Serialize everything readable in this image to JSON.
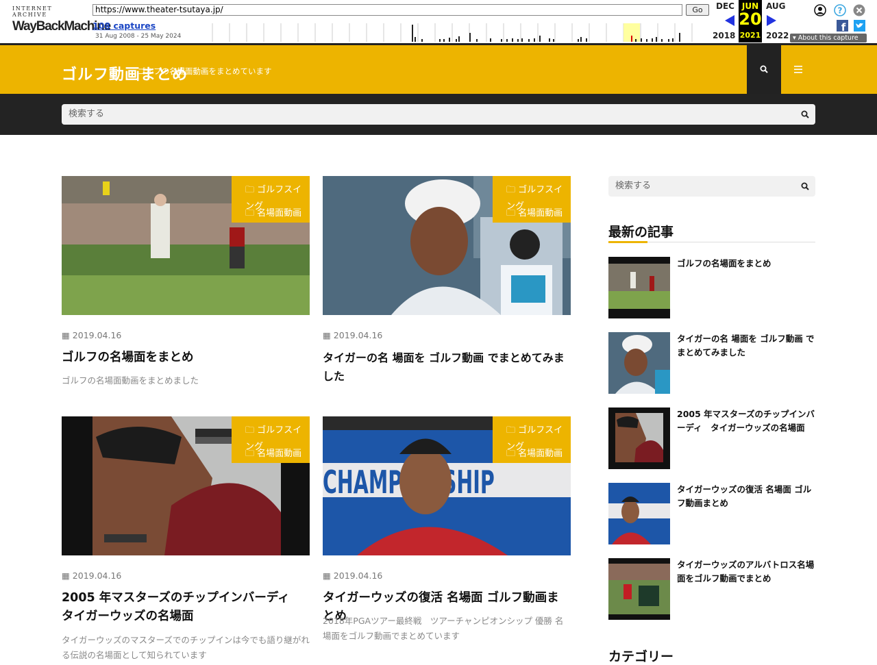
{
  "wayback": {
    "logo_top": "INTERNET ARCHIVE",
    "logo_main": "WayBack",
    "logo_main2": "Machine",
    "url": "https://www.theater-tsutaya.jp/",
    "go_label": "Go",
    "captures": "108 captures",
    "range": "31 Aug 2008 - 25 May 2024",
    "prev_month": "DEC",
    "cur_month": "JUN",
    "next_month": "AUG",
    "cur_day": "20",
    "prev_year": "2018",
    "cur_year": "2021",
    "next_year": "2022",
    "about": "About this capture"
  },
  "header": {
    "title": "ゴルフ動画まとめ",
    "description": "ゴルフの名場面動画をまとめています"
  },
  "search": {
    "placeholder": "検索する"
  },
  "cards": [
    {
      "cat1": "ゴルフスイング",
      "cat2": "名場面動画",
      "date": "2019.04.16",
      "title": "ゴルフの名場面をまとめ",
      "excerpt": "ゴルフの名場面動画をまとめました"
    },
    {
      "cat1": "ゴルフスイング",
      "cat2": "名場面動画",
      "date": "2019.04.16",
      "title": "タイガーの名 場面を ゴルフ動画 でまとめてみました",
      "excerpt": ""
    },
    {
      "cat1": "ゴルフスイング",
      "cat2": "名場面動画",
      "date": "2019.04.16",
      "title": "2005 年マスターズのチップインバーディ　タイガーウッズの名場面",
      "excerpt": "タイガーウッズのマスターズでのチップインは今でも語り継がれる伝説の名場面として知られています"
    },
    {
      "cat1": "ゴルフスイング",
      "cat2": "名場面動画",
      "date": "2019.04.16",
      "title": "タイガーウッズの復活 名場面 ゴルフ動画まとめ",
      "excerpt": "2018年PGAツアー最終戦　ツアーチャンピオンシップ 優勝 名場面をゴルフ動画でまとめています"
    }
  ],
  "sidebar": {
    "search_placeholder": "検索する",
    "recent_heading": "最新の記事",
    "items": [
      "ゴルフの名場面をまとめ",
      "タイガーの名 場面を ゴルフ動画 でまとめてみました",
      "2005 年マスターズのチップインバーディ　タイガーウッズの名場面",
      "タイガーウッズの復活 名場面 ゴルフ動画まとめ",
      "タイガーウッズのアルバトロス名場面をゴルフ動画でまとめ"
    ],
    "category_heading": "カテゴリー"
  },
  "colors": {
    "accent": "#edb400",
    "dark": "#232323",
    "wayback_red": "#b41e1e",
    "wayback_blue": "#2233e0"
  }
}
